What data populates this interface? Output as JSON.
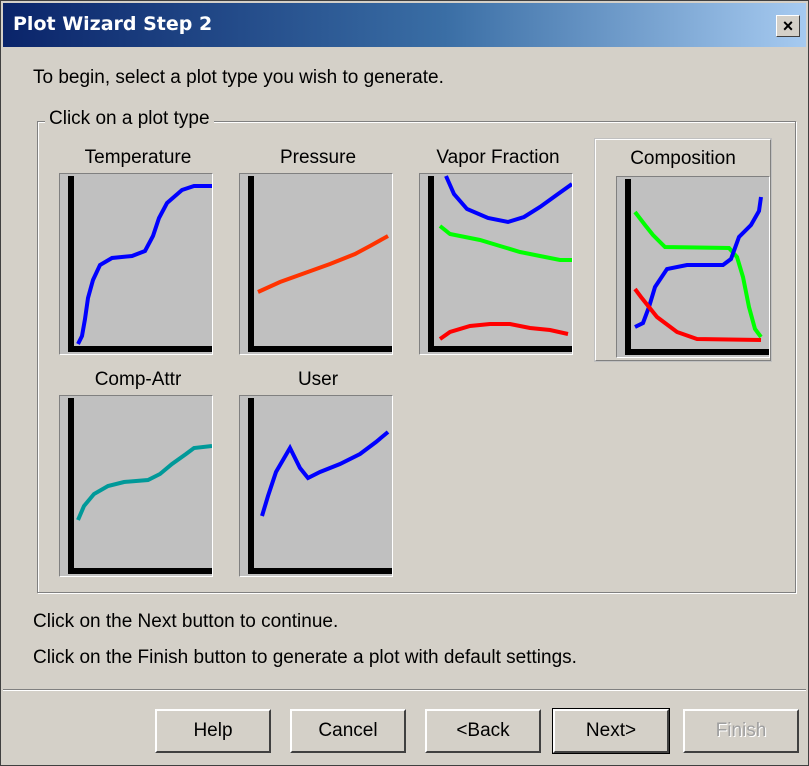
{
  "window": {
    "title": "Plot Wizard Step 2",
    "close_label": "×"
  },
  "intro_text": "To begin, select a plot type you wish to generate.",
  "group": {
    "legend": "Click on a plot type",
    "selected": "Composition",
    "plot_types": [
      {
        "label": "Temperature"
      },
      {
        "label": "Pressure"
      },
      {
        "label": "Vapor Fraction"
      },
      {
        "label": "Composition"
      },
      {
        "label": "Comp-Attr"
      },
      {
        "label": "User"
      }
    ]
  },
  "messages": {
    "next": "Click on the Next button to continue.",
    "finish": "Click on the Finish button to generate a plot with default settings."
  },
  "buttons": {
    "help": "Help",
    "cancel": "Cancel",
    "back": "<Back",
    "next": "Next>",
    "finish": "Finish"
  },
  "colors": {
    "blue_curve": "#0000ff",
    "orange_curve": "#ff3300",
    "green_curve": "#00ff00",
    "red_curve": "#ff0000",
    "teal_curve": "#009999",
    "thumb_bg": "#c0c0c0",
    "title_gradient_start": "#0a246a",
    "title_gradient_end": "#a6caf0"
  }
}
